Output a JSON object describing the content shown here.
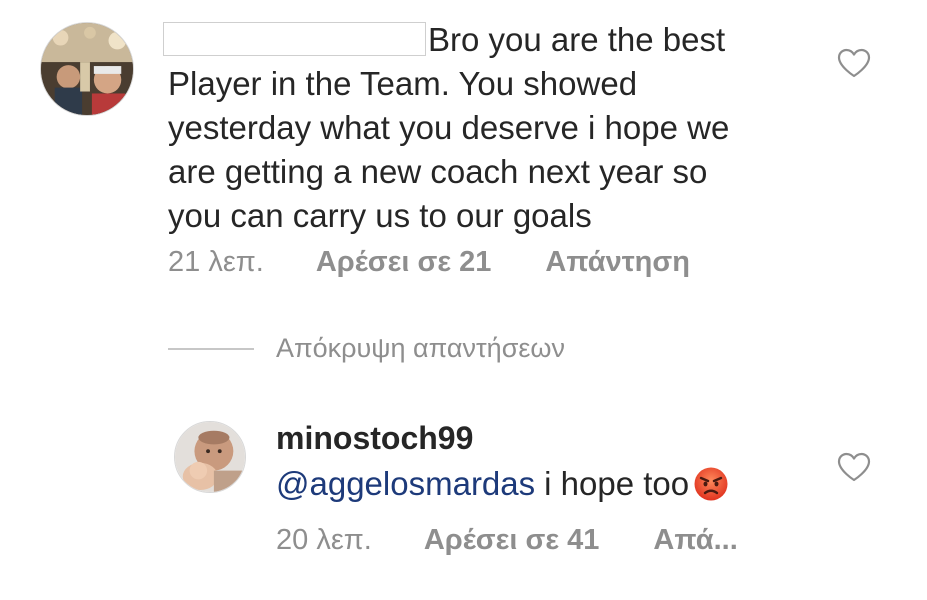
{
  "comment": {
    "text": "Bro you are the best\nPlayer in the Team. You showed\nyesterday what you deserve i hope we\nare getting a new coach next year so\nyou can carry us to our goals",
    "time": "21 λεπ.",
    "likes": "Αρέσει σε 21",
    "reply": "Απάντηση"
  },
  "hide_replies": {
    "label": "Απόκρυψη απαντήσεων"
  },
  "reply_comment": {
    "username": "minostoch99",
    "mention": "@aggelosmardas",
    "text": "i hope too",
    "emoji": "angry-face-icon",
    "time": "20 λεπ.",
    "likes": "Αρέσει σε 41",
    "reply": "Απά..."
  },
  "colors": {
    "text": "#262626",
    "meta": "#8e8e8e",
    "mention": "#1d3a7a",
    "divider": "#c7c7c7"
  }
}
